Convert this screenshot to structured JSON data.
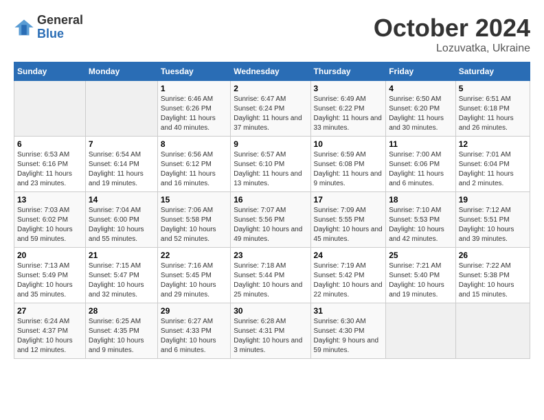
{
  "header": {
    "logo_general": "General",
    "logo_blue": "Blue",
    "month_title": "October 2024",
    "location": "Lozuvatka, Ukraine"
  },
  "calendar": {
    "days_of_week": [
      "Sunday",
      "Monday",
      "Tuesday",
      "Wednesday",
      "Thursday",
      "Friday",
      "Saturday"
    ],
    "weeks": [
      [
        {
          "day": "",
          "sunrise": "",
          "sunset": "",
          "daylight": ""
        },
        {
          "day": "",
          "sunrise": "",
          "sunset": "",
          "daylight": ""
        },
        {
          "day": "1",
          "sunrise": "Sunrise: 6:46 AM",
          "sunset": "Sunset: 6:26 PM",
          "daylight": "Daylight: 11 hours and 40 minutes."
        },
        {
          "day": "2",
          "sunrise": "Sunrise: 6:47 AM",
          "sunset": "Sunset: 6:24 PM",
          "daylight": "Daylight: 11 hours and 37 minutes."
        },
        {
          "day": "3",
          "sunrise": "Sunrise: 6:49 AM",
          "sunset": "Sunset: 6:22 PM",
          "daylight": "Daylight: 11 hours and 33 minutes."
        },
        {
          "day": "4",
          "sunrise": "Sunrise: 6:50 AM",
          "sunset": "Sunset: 6:20 PM",
          "daylight": "Daylight: 11 hours and 30 minutes."
        },
        {
          "day": "5",
          "sunrise": "Sunrise: 6:51 AM",
          "sunset": "Sunset: 6:18 PM",
          "daylight": "Daylight: 11 hours and 26 minutes."
        }
      ],
      [
        {
          "day": "6",
          "sunrise": "Sunrise: 6:53 AM",
          "sunset": "Sunset: 6:16 PM",
          "daylight": "Daylight: 11 hours and 23 minutes."
        },
        {
          "day": "7",
          "sunrise": "Sunrise: 6:54 AM",
          "sunset": "Sunset: 6:14 PM",
          "daylight": "Daylight: 11 hours and 19 minutes."
        },
        {
          "day": "8",
          "sunrise": "Sunrise: 6:56 AM",
          "sunset": "Sunset: 6:12 PM",
          "daylight": "Daylight: 11 hours and 16 minutes."
        },
        {
          "day": "9",
          "sunrise": "Sunrise: 6:57 AM",
          "sunset": "Sunset: 6:10 PM",
          "daylight": "Daylight: 11 hours and 13 minutes."
        },
        {
          "day": "10",
          "sunrise": "Sunrise: 6:59 AM",
          "sunset": "Sunset: 6:08 PM",
          "daylight": "Daylight: 11 hours and 9 minutes."
        },
        {
          "day": "11",
          "sunrise": "Sunrise: 7:00 AM",
          "sunset": "Sunset: 6:06 PM",
          "daylight": "Daylight: 11 hours and 6 minutes."
        },
        {
          "day": "12",
          "sunrise": "Sunrise: 7:01 AM",
          "sunset": "Sunset: 6:04 PM",
          "daylight": "Daylight: 11 hours and 2 minutes."
        }
      ],
      [
        {
          "day": "13",
          "sunrise": "Sunrise: 7:03 AM",
          "sunset": "Sunset: 6:02 PM",
          "daylight": "Daylight: 10 hours and 59 minutes."
        },
        {
          "day": "14",
          "sunrise": "Sunrise: 7:04 AM",
          "sunset": "Sunset: 6:00 PM",
          "daylight": "Daylight: 10 hours and 55 minutes."
        },
        {
          "day": "15",
          "sunrise": "Sunrise: 7:06 AM",
          "sunset": "Sunset: 5:58 PM",
          "daylight": "Daylight: 10 hours and 52 minutes."
        },
        {
          "day": "16",
          "sunrise": "Sunrise: 7:07 AM",
          "sunset": "Sunset: 5:56 PM",
          "daylight": "Daylight: 10 hours and 49 minutes."
        },
        {
          "day": "17",
          "sunrise": "Sunrise: 7:09 AM",
          "sunset": "Sunset: 5:55 PM",
          "daylight": "Daylight: 10 hours and 45 minutes."
        },
        {
          "day": "18",
          "sunrise": "Sunrise: 7:10 AM",
          "sunset": "Sunset: 5:53 PM",
          "daylight": "Daylight: 10 hours and 42 minutes."
        },
        {
          "day": "19",
          "sunrise": "Sunrise: 7:12 AM",
          "sunset": "Sunset: 5:51 PM",
          "daylight": "Daylight: 10 hours and 39 minutes."
        }
      ],
      [
        {
          "day": "20",
          "sunrise": "Sunrise: 7:13 AM",
          "sunset": "Sunset: 5:49 PM",
          "daylight": "Daylight: 10 hours and 35 minutes."
        },
        {
          "day": "21",
          "sunrise": "Sunrise: 7:15 AM",
          "sunset": "Sunset: 5:47 PM",
          "daylight": "Daylight: 10 hours and 32 minutes."
        },
        {
          "day": "22",
          "sunrise": "Sunrise: 7:16 AM",
          "sunset": "Sunset: 5:45 PM",
          "daylight": "Daylight: 10 hours and 29 minutes."
        },
        {
          "day": "23",
          "sunrise": "Sunrise: 7:18 AM",
          "sunset": "Sunset: 5:44 PM",
          "daylight": "Daylight: 10 hours and 25 minutes."
        },
        {
          "day": "24",
          "sunrise": "Sunrise: 7:19 AM",
          "sunset": "Sunset: 5:42 PM",
          "daylight": "Daylight: 10 hours and 22 minutes."
        },
        {
          "day": "25",
          "sunrise": "Sunrise: 7:21 AM",
          "sunset": "Sunset: 5:40 PM",
          "daylight": "Daylight: 10 hours and 19 minutes."
        },
        {
          "day": "26",
          "sunrise": "Sunrise: 7:22 AM",
          "sunset": "Sunset: 5:38 PM",
          "daylight": "Daylight: 10 hours and 15 minutes."
        }
      ],
      [
        {
          "day": "27",
          "sunrise": "Sunrise: 6:24 AM",
          "sunset": "Sunset: 4:37 PM",
          "daylight": "Daylight: 10 hours and 12 minutes."
        },
        {
          "day": "28",
          "sunrise": "Sunrise: 6:25 AM",
          "sunset": "Sunset: 4:35 PM",
          "daylight": "Daylight: 10 hours and 9 minutes."
        },
        {
          "day": "29",
          "sunrise": "Sunrise: 6:27 AM",
          "sunset": "Sunset: 4:33 PM",
          "daylight": "Daylight: 10 hours and 6 minutes."
        },
        {
          "day": "30",
          "sunrise": "Sunrise: 6:28 AM",
          "sunset": "Sunset: 4:31 PM",
          "daylight": "Daylight: 10 hours and 3 minutes."
        },
        {
          "day": "31",
          "sunrise": "Sunrise: 6:30 AM",
          "sunset": "Sunset: 4:30 PM",
          "daylight": "Daylight: 9 hours and 59 minutes."
        },
        {
          "day": "",
          "sunrise": "",
          "sunset": "",
          "daylight": ""
        },
        {
          "day": "",
          "sunrise": "",
          "sunset": "",
          "daylight": ""
        }
      ]
    ]
  }
}
